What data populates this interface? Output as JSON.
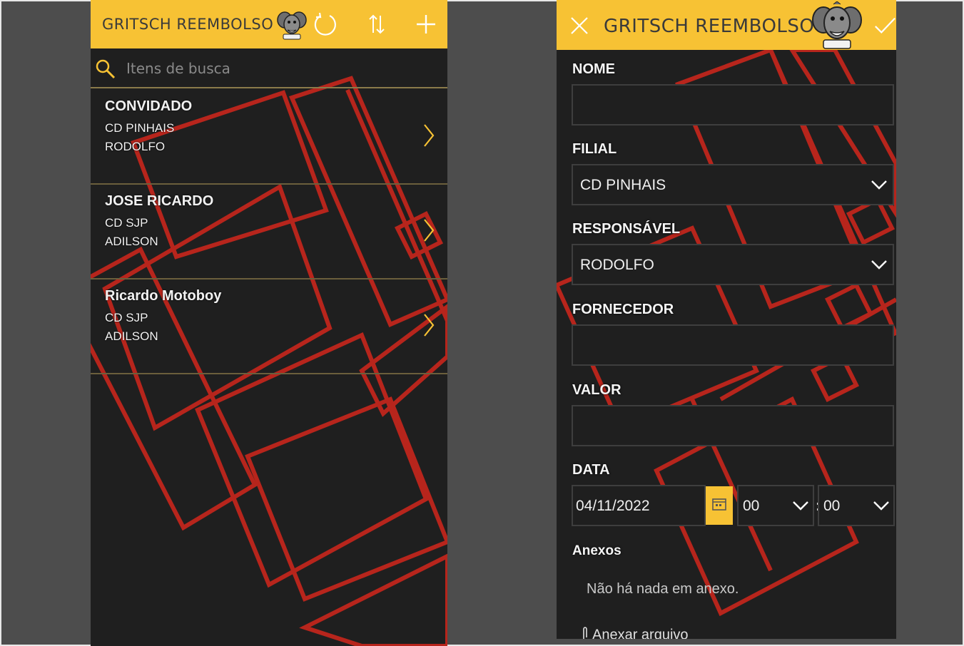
{
  "list_screen": {
    "header": {
      "title": "GRITSCH REEMBOLSO",
      "icons": [
        "mascot-icon",
        "refresh-icon",
        "sort-icon",
        "add-icon"
      ]
    },
    "search": {
      "placeholder": "Itens de busca",
      "icon": "search-icon"
    },
    "items": [
      {
        "name": "CONVIDADO",
        "filial": "CD PINHAIS",
        "responsavel": "RODOLFO"
      },
      {
        "name": "JOSE RICARDO",
        "filial": "CD SJP",
        "responsavel": "ADILSON"
      },
      {
        "name": "Ricardo Motoboy",
        "filial": "CD SJP",
        "responsavel": "ADILSON"
      }
    ]
  },
  "form_screen": {
    "header": {
      "title": "GRITSCH REEMBOLSO",
      "icons": [
        "close-icon",
        "mascot-icon",
        "check-icon"
      ]
    },
    "fields": {
      "nome": {
        "label": "NOME",
        "value": ""
      },
      "filial": {
        "label": "FILIAL",
        "value": "CD PINHAIS"
      },
      "responsavel": {
        "label": "RESPONSÁVEL",
        "value": "RODOLFO"
      },
      "fornecedor": {
        "label": "FORNECEDOR",
        "value": ""
      },
      "valor": {
        "label": "VALOR",
        "value": ""
      },
      "data": {
        "label": "DATA",
        "date": "04/11/2022",
        "hour": "00",
        "minute": "00",
        "separator": ":"
      }
    },
    "attachments": {
      "label": "Anexos",
      "empty_text": "Não há nada em anexo.",
      "add_label": "Anexar arquivo"
    }
  },
  "colors": {
    "header": "#f7c234",
    "background": "#1f1f1f",
    "art_red": "#c8261c",
    "divider": "#6b5f3c"
  }
}
